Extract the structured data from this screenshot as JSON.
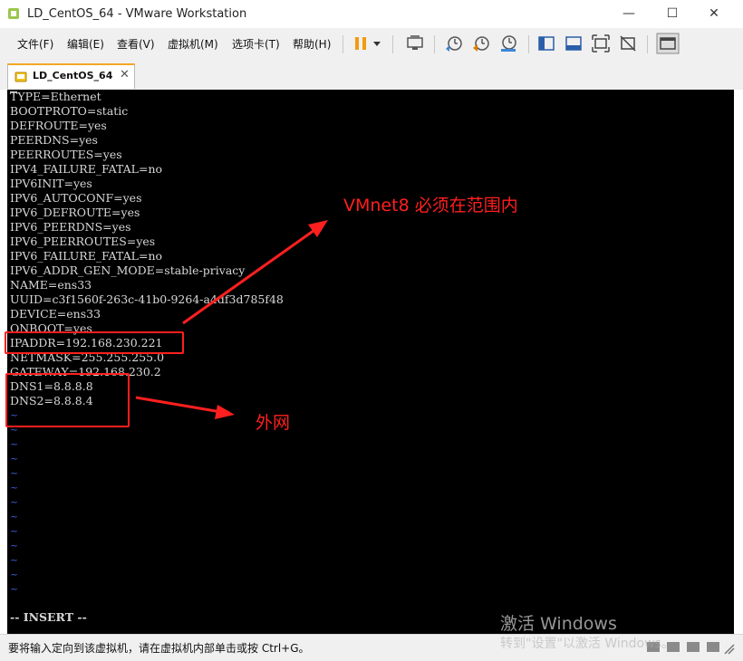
{
  "window": {
    "title": "LD_CentOS_64 - VMware Workstation",
    "controls": [
      "—",
      "☐",
      "✕"
    ]
  },
  "menu": {
    "items": [
      "文件(F)",
      "编辑(E)",
      "查看(V)",
      "虚拟机(M)",
      "选项卡(T)",
      "帮助(H)"
    ]
  },
  "toolbar": {
    "icons": [
      "pause-icon",
      "dropdown-arrow-icon",
      "send-ctrl-alt-del-icon",
      "snapshot-take-icon",
      "snapshot-revert-icon",
      "snapshot-manager-icon",
      "sidebar-toggle-icon",
      "console-view-icon",
      "fullscreen-icon",
      "unity-icon",
      "thumbnail-view-icon"
    ]
  },
  "tab": {
    "label": "LD_CentOS_64",
    "close": "✕"
  },
  "console": {
    "lines": [
      "TYPE=Ethernet",
      "BOOTPROTO=static",
      "DEFROUTE=yes",
      "PEERDNS=yes",
      "PEERROUTES=yes",
      "IPV4_FAILURE_FATAL=no",
      "IPV6INIT=yes",
      "IPV6_AUTOCONF=yes",
      "IPV6_DEFROUTE=yes",
      "IPV6_PEERDNS=yes",
      "IPV6_PEERROUTES=yes",
      "IPV6_FAILURE_FATAL=no",
      "IPV6_ADDR_GEN_MODE=stable-privacy",
      "NAME=ens33",
      "UUID=c3f1560f-263c-41b0-9264-a4df3d785f48",
      "DEVICE=ens33",
      "ONBOOT=yes",
      "IPADDR=192.168.230.221",
      "NETMASK=255.255.255.0",
      "GATEWAY=192.168.230.2",
      "DNS1=8.8.8.8",
      "DNS2=8.8.8.4"
    ],
    "tilde": "~",
    "mode": "-- INSERT --"
  },
  "annotations": {
    "vmnet_note": "VMnet8 必须在范围内",
    "dns_note": "外网",
    "color": "#ff1f1f"
  },
  "statusbar": {
    "text": "要将输入定向到该虚拟机，请在虚拟机内部单击或按 Ctrl+G。"
  },
  "watermark": {
    "line1": "激活 Windows",
    "line2": "转到\"设置\"以激活 Windows。"
  },
  "colors": {
    "console_bg": "#000000",
    "console_text": "#d8d8d8",
    "tilde": "#3d5fd9",
    "accent_orange": "#f5a623"
  }
}
